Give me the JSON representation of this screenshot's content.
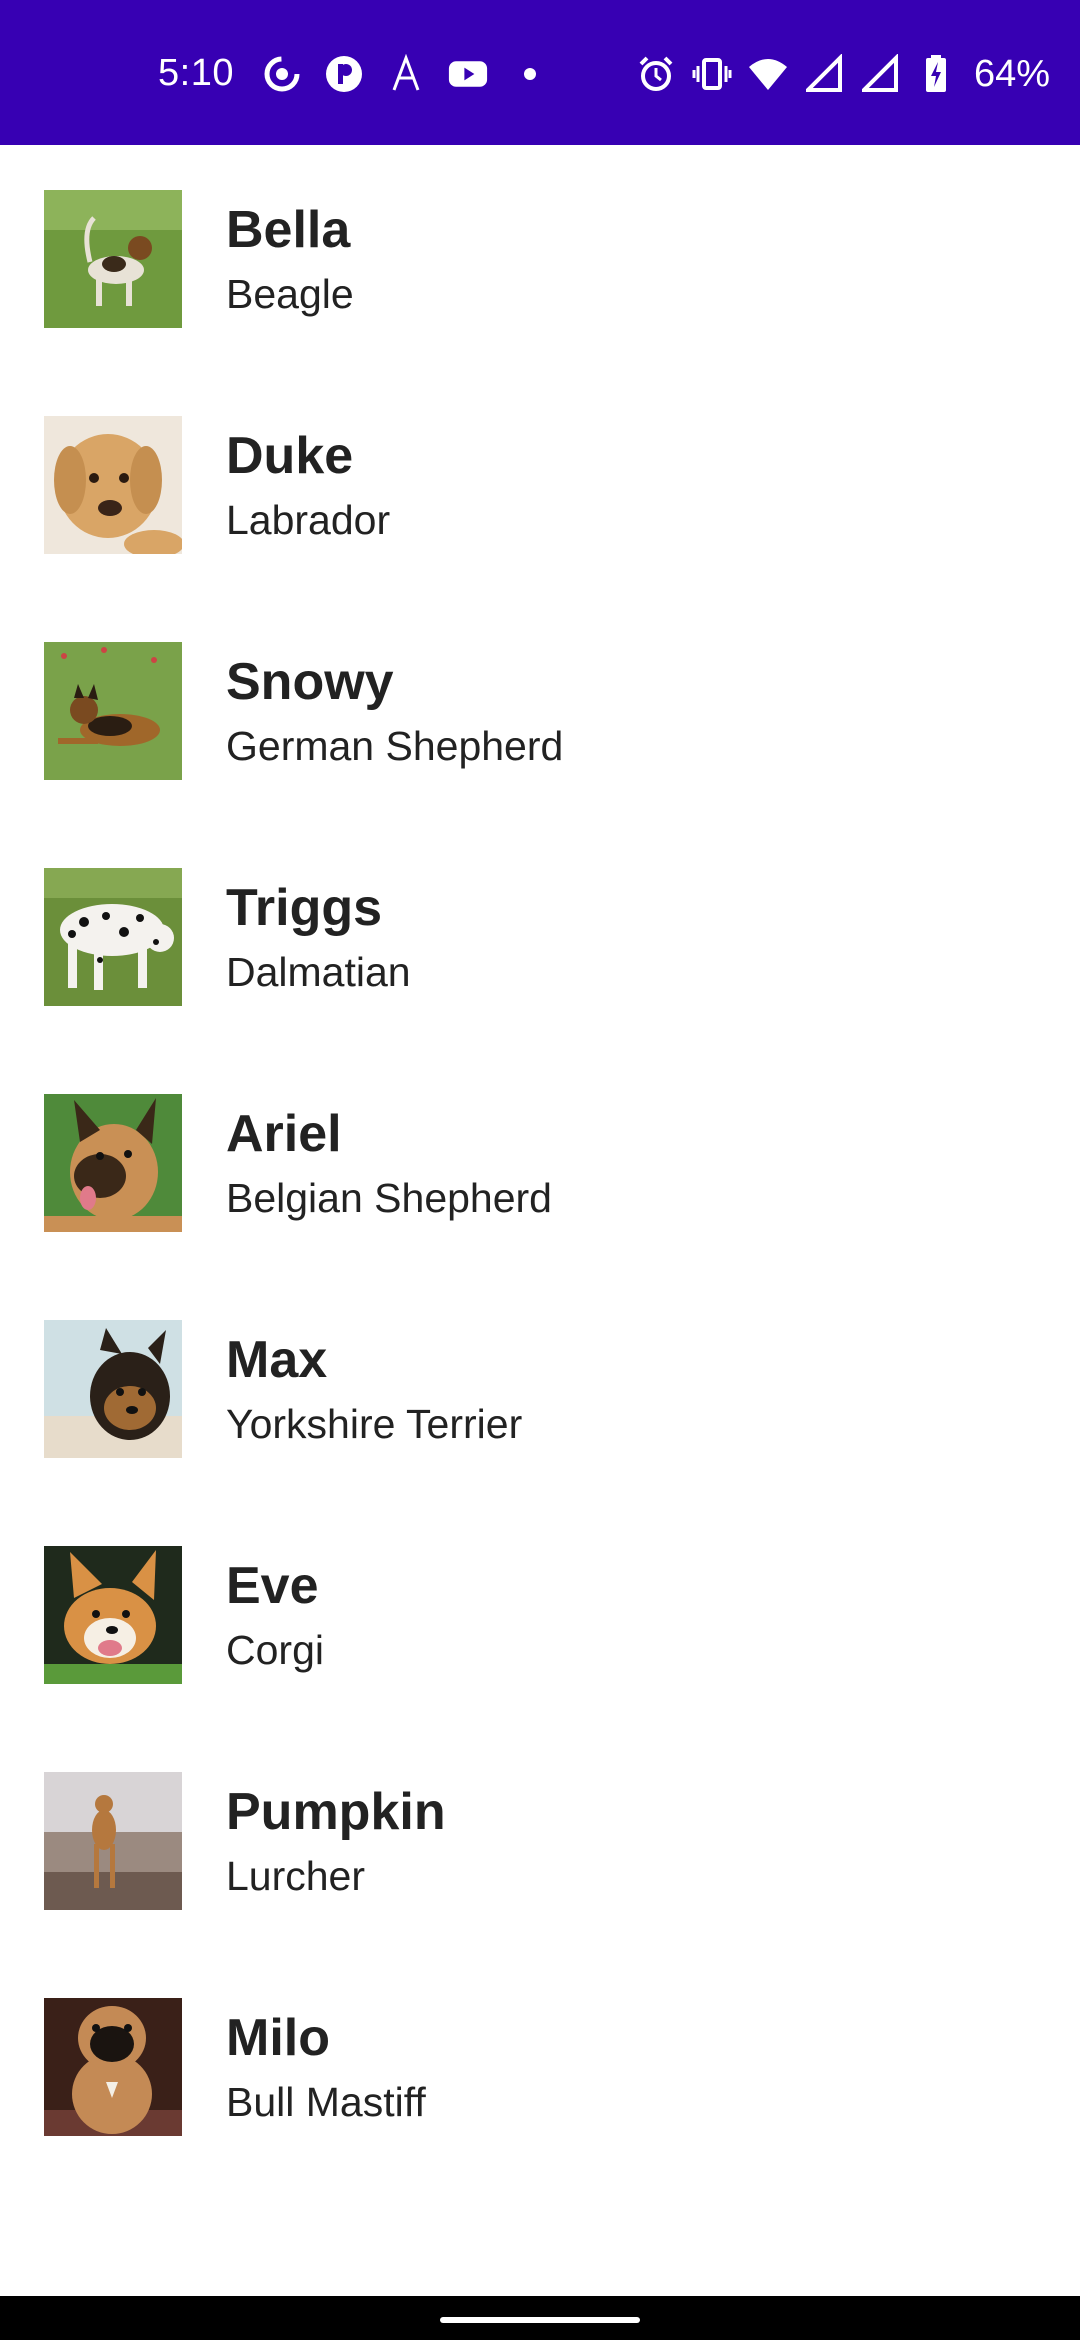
{
  "status_bar": {
    "time": "5:10",
    "battery_percent": "64%",
    "left_icons": [
      "notification-icon",
      "notification-icon",
      "font-icon",
      "youtube-icon",
      "dot-icon"
    ],
    "right_icons": [
      "alarm-icon",
      "vibrate-icon",
      "wifi-icon",
      "signal-icon",
      "signal-icon",
      "battery-charging-icon"
    ],
    "background_color": "#3700B3"
  },
  "dogs": [
    {
      "name": "Bella",
      "breed": "Beagle"
    },
    {
      "name": "Duke",
      "breed": "Labrador"
    },
    {
      "name": "Snowy",
      "breed": "German Shepherd"
    },
    {
      "name": "Triggs",
      "breed": "Dalmatian"
    },
    {
      "name": "Ariel",
      "breed": "Belgian Shepherd"
    },
    {
      "name": "Max",
      "breed": "Yorkshire Terrier"
    },
    {
      "name": "Eve",
      "breed": "Corgi"
    },
    {
      "name": "Pumpkin",
      "breed": "Lurcher"
    },
    {
      "name": "Milo",
      "breed": "Bull Mastiff"
    }
  ]
}
